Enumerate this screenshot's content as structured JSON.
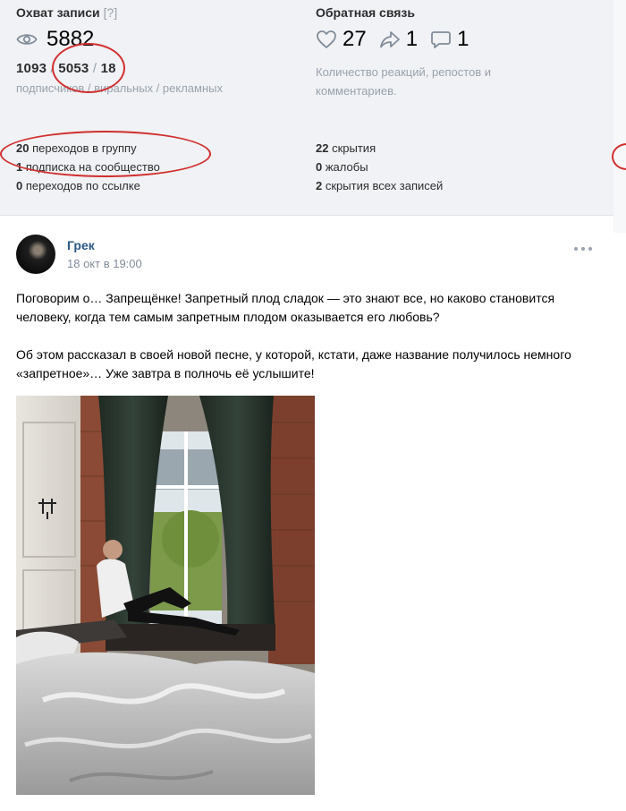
{
  "reach": {
    "title": "Охват записи",
    "help": "[?]",
    "views": "5882",
    "subscribers": "1093",
    "viral": "5053",
    "ads": "18",
    "sep": "/",
    "caption": "подписчиков / виральных / рекламных",
    "group_transitions_num": "20",
    "group_transitions_label": "переходов в группу",
    "subscriptions_num": "1",
    "subscriptions_label": "подписка на сообщество",
    "link_transitions_num": "0",
    "link_transitions_label": "переходов по ссылке"
  },
  "feedback": {
    "title": "Обратная связь",
    "likes": "27",
    "reposts": "1",
    "comments": "1",
    "caption": "Количество реакций, репостов и комментариев.",
    "hides_num": "22",
    "hides_label": "скрытия",
    "complaints_num": "0",
    "complaints_label": "жалобы",
    "hide_all_num": "2",
    "hide_all_label": "скрытия всех записей"
  },
  "post": {
    "author": "Грек",
    "date": "18 окт в 19:00",
    "paragraph1": "Поговорим о… Запрещёнке! Запретный плод сладок — это знают все, но каково становится человеку, когда тем самым запретным плодом оказывается его любовь?",
    "paragraph2": "Об этом рассказал в своей новой песне, у которой, кстати, даже название получилось немного «запретное»… Уже завтра в полночь её услышите!"
  },
  "icons": {
    "views": "eye-icon",
    "likes": "heart-icon",
    "reposts": "share-icon",
    "comments": "comment-icon",
    "more": "more-dots-icon"
  },
  "colors": {
    "annotation": "#d12f2f",
    "link": "#2a5885",
    "muted": "#99a2ad",
    "panel": "#f0f2f5"
  }
}
